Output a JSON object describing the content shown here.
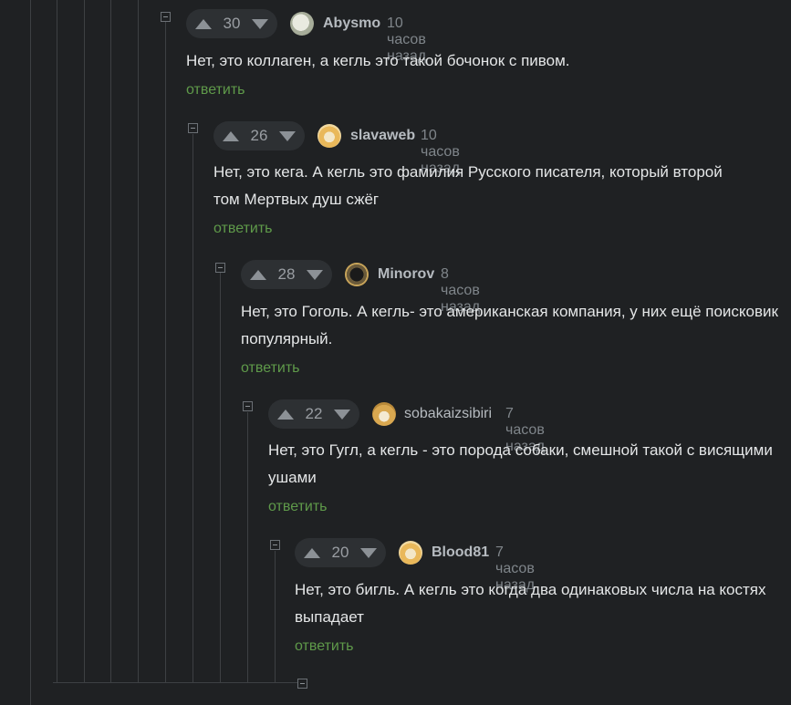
{
  "comments": [
    {
      "score": "30",
      "user": "Abysmo",
      "time": "10 часов назад",
      "text": "Нет, это коллаген, а кегль это такой бочонок с пивом.",
      "reply": "ответить",
      "avatar": "avatar-light"
    },
    {
      "score": "26",
      "user": "slavaweb",
      "time": "10 часов назад",
      "text": "Нет, это кега. А кегль это фамилия Русского писателя, который второй том Мертвых душ сжёг",
      "reply": "ответить",
      "avatar": "avatar-beer"
    },
    {
      "score": "28",
      "user": "Minorov",
      "time": "8 часов назад",
      "text": "Нет, это Гоголь. А кегль- это американская компания, у них ещё поисковик популярный.",
      "reply": "ответить",
      "avatar": "avatar-dark"
    },
    {
      "score": "22",
      "user": "sobakaizsibiri",
      "time": "7 часов назад",
      "text": "Нет, это Гугл, а кегль - это порода собаки, смешной такой с висящими ушами",
      "reply": "ответить",
      "avatar": "avatar-doge"
    },
    {
      "score": "20",
      "user": "Blood81",
      "time": "7 часов назад",
      "text": "Нет, это бигль. А кегль это когда два одинаковых числа на костях выпадает",
      "reply": "ответить",
      "avatar": "avatar-beer"
    }
  ],
  "colors": {
    "background": "#1f2123",
    "reply": "#5f9a4a",
    "username": "#b6bbc0"
  }
}
